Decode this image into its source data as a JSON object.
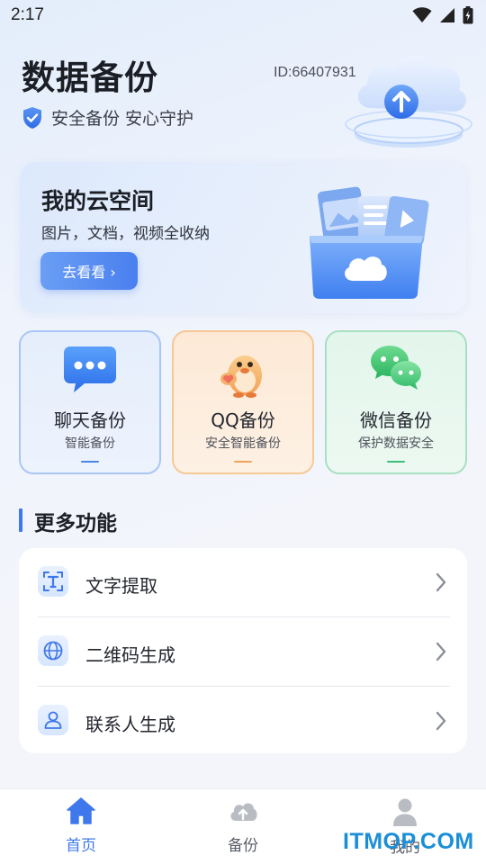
{
  "status_bar": {
    "time": "2:17"
  },
  "header": {
    "title": "数据备份",
    "subtitle": "安全备份 安心守护",
    "user_id": "ID:66407931"
  },
  "cloud_card": {
    "title": "我的云空间",
    "description": "图片，文档，视频全收纳",
    "button_label": "去看看 ›"
  },
  "features": [
    {
      "title": "聊天备份",
      "subtitle": "智能备份",
      "accent": "#4a86ea"
    },
    {
      "title": "QQ备份",
      "subtitle": "安全智能备份",
      "accent": "#f0a35a"
    },
    {
      "title": "微信备份",
      "subtitle": "保护数据安全",
      "accent": "#3cbf79"
    }
  ],
  "more_functions": {
    "heading": "更多功能",
    "items": [
      {
        "label": "文字提取",
        "icon": "text-recognition-icon"
      },
      {
        "label": "二维码生成",
        "icon": "globe-icon"
      },
      {
        "label": "联系人生成",
        "icon": "contact-icon"
      }
    ]
  },
  "bottom_nav": {
    "items": [
      {
        "label": "首页",
        "icon": "home-icon",
        "active": true
      },
      {
        "label": "备份",
        "icon": "cloud-upload-icon",
        "active": false
      },
      {
        "label": "我的",
        "icon": "person-icon",
        "active": false
      }
    ],
    "active_color": "#3f78ec",
    "inactive_color": "#5a5e67"
  },
  "watermark": "ITMOP.COM"
}
